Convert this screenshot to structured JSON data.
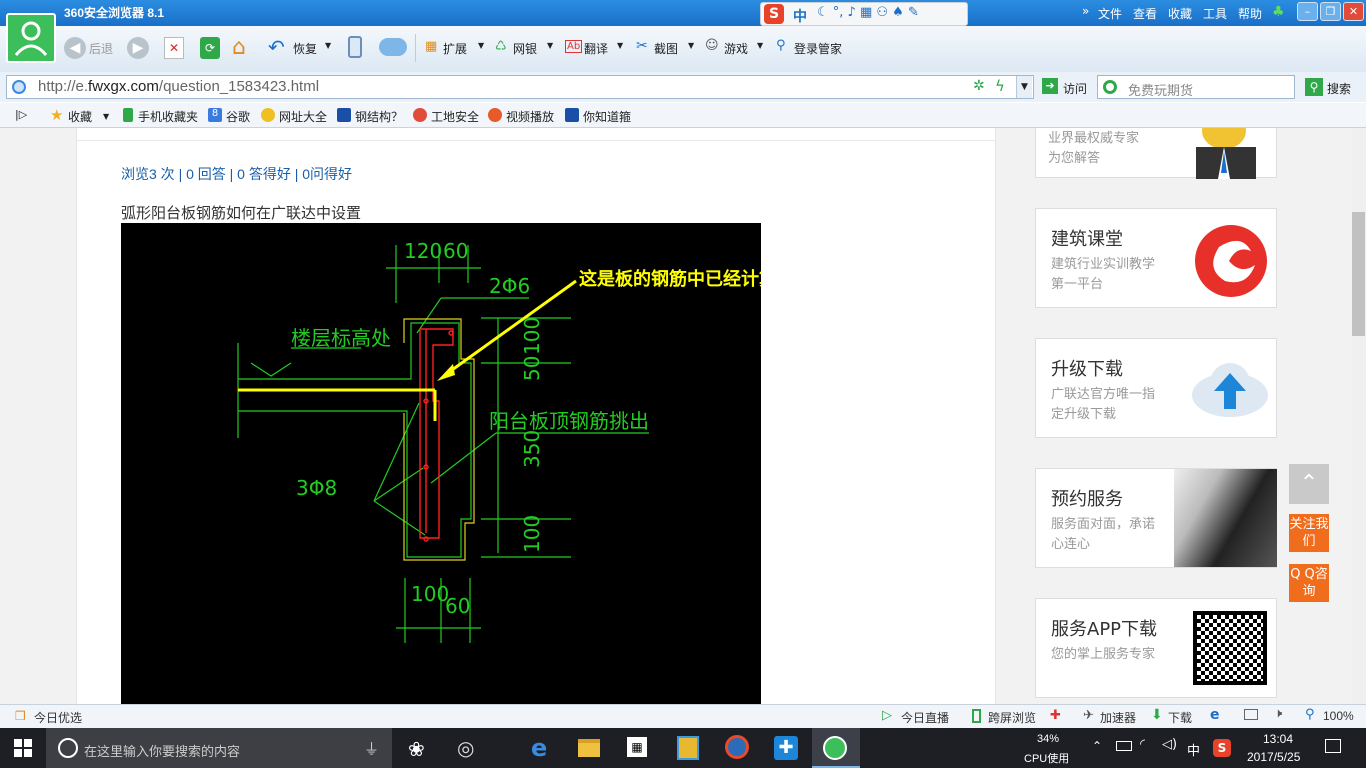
{
  "browser": {
    "app_name": "360安全浏览器 8.1"
  },
  "ime": {
    "label": "中"
  },
  "menu": [
    "文件",
    "查看",
    "收藏",
    "工具",
    "帮助"
  ],
  "window_controls": [
    "–",
    "❐",
    "✕"
  ],
  "toolbar": {
    "back": "后退",
    "restore": "恢复",
    "extend": "扩展",
    "netbank": "网银",
    "translate": "翻译",
    "screenshot": "截图",
    "games": "游戏",
    "login": "登录管家"
  },
  "address": {
    "url_prefix": "http://e.",
    "url_host": "fwxgx.com",
    "url_path": "/question_1583423.html",
    "visit": "访问",
    "search_placeholder": "免费玩期货",
    "search_button": "搜索"
  },
  "favorites": [
    "收藏",
    "手机收藏夹",
    "谷歌",
    "网址大全",
    "钢结构？",
    "工地安全",
    "视频播放",
    "你知道箍"
  ],
  "question": {
    "stats": "浏览3 次 | 0 回答 | 0 答得好 | 0问得好",
    "title": "弧形阳台板钢筋如何在广联达中设置"
  },
  "drawing": {
    "annotation": "这是板的钢筋中已经计算",
    "dim_120": "120",
    "dim_60": "60",
    "dim_2phi6": "2Φ6",
    "floor_label": "楼层标高处",
    "dim_50": "50",
    "dim_100": "100",
    "balcony_label": "阳台板顶钢筋挑出",
    "dim_3phi8": "3Φ8",
    "dim_350": "350",
    "dim_100b": "100",
    "dim_100c": "100",
    "dim_60b": "60"
  },
  "sidebar": {
    "partial": {
      "line1": "业界最权威专家",
      "line2": "为您解答"
    },
    "cards": [
      {
        "title": "建筑课堂",
        "sub": "建筑行业实训教学第一平台"
      },
      {
        "title": "升级下载",
        "sub": "广联达官方唯一指定升级下载"
      },
      {
        "title": "预约服务",
        "sub": "服务面对面，承诺心连心"
      },
      {
        "title": "服务APP下载",
        "sub": "您的掌上服务专家"
      }
    ]
  },
  "float": {
    "follow": "关注我们",
    "qq": "Q Q咨询"
  },
  "status": {
    "today": "今日优选",
    "live": "今日直播",
    "cross": "跨屏浏览",
    "accel": "加速器",
    "download": "下载",
    "zoom": "100%"
  },
  "taskbar": {
    "search_placeholder": "在这里输入你要搜索的内容",
    "cpu": "34%",
    "cpu_label": "CPU使用",
    "ime": "中",
    "time": "13:04",
    "date": "2017/5/25"
  },
  "colors": {
    "title_blue": "#1a6fc9",
    "accent_orange": "#f06d1e",
    "cad_green": "#22cc22",
    "cad_yellow": "#ffff00",
    "cad_red": "#ff2020"
  }
}
